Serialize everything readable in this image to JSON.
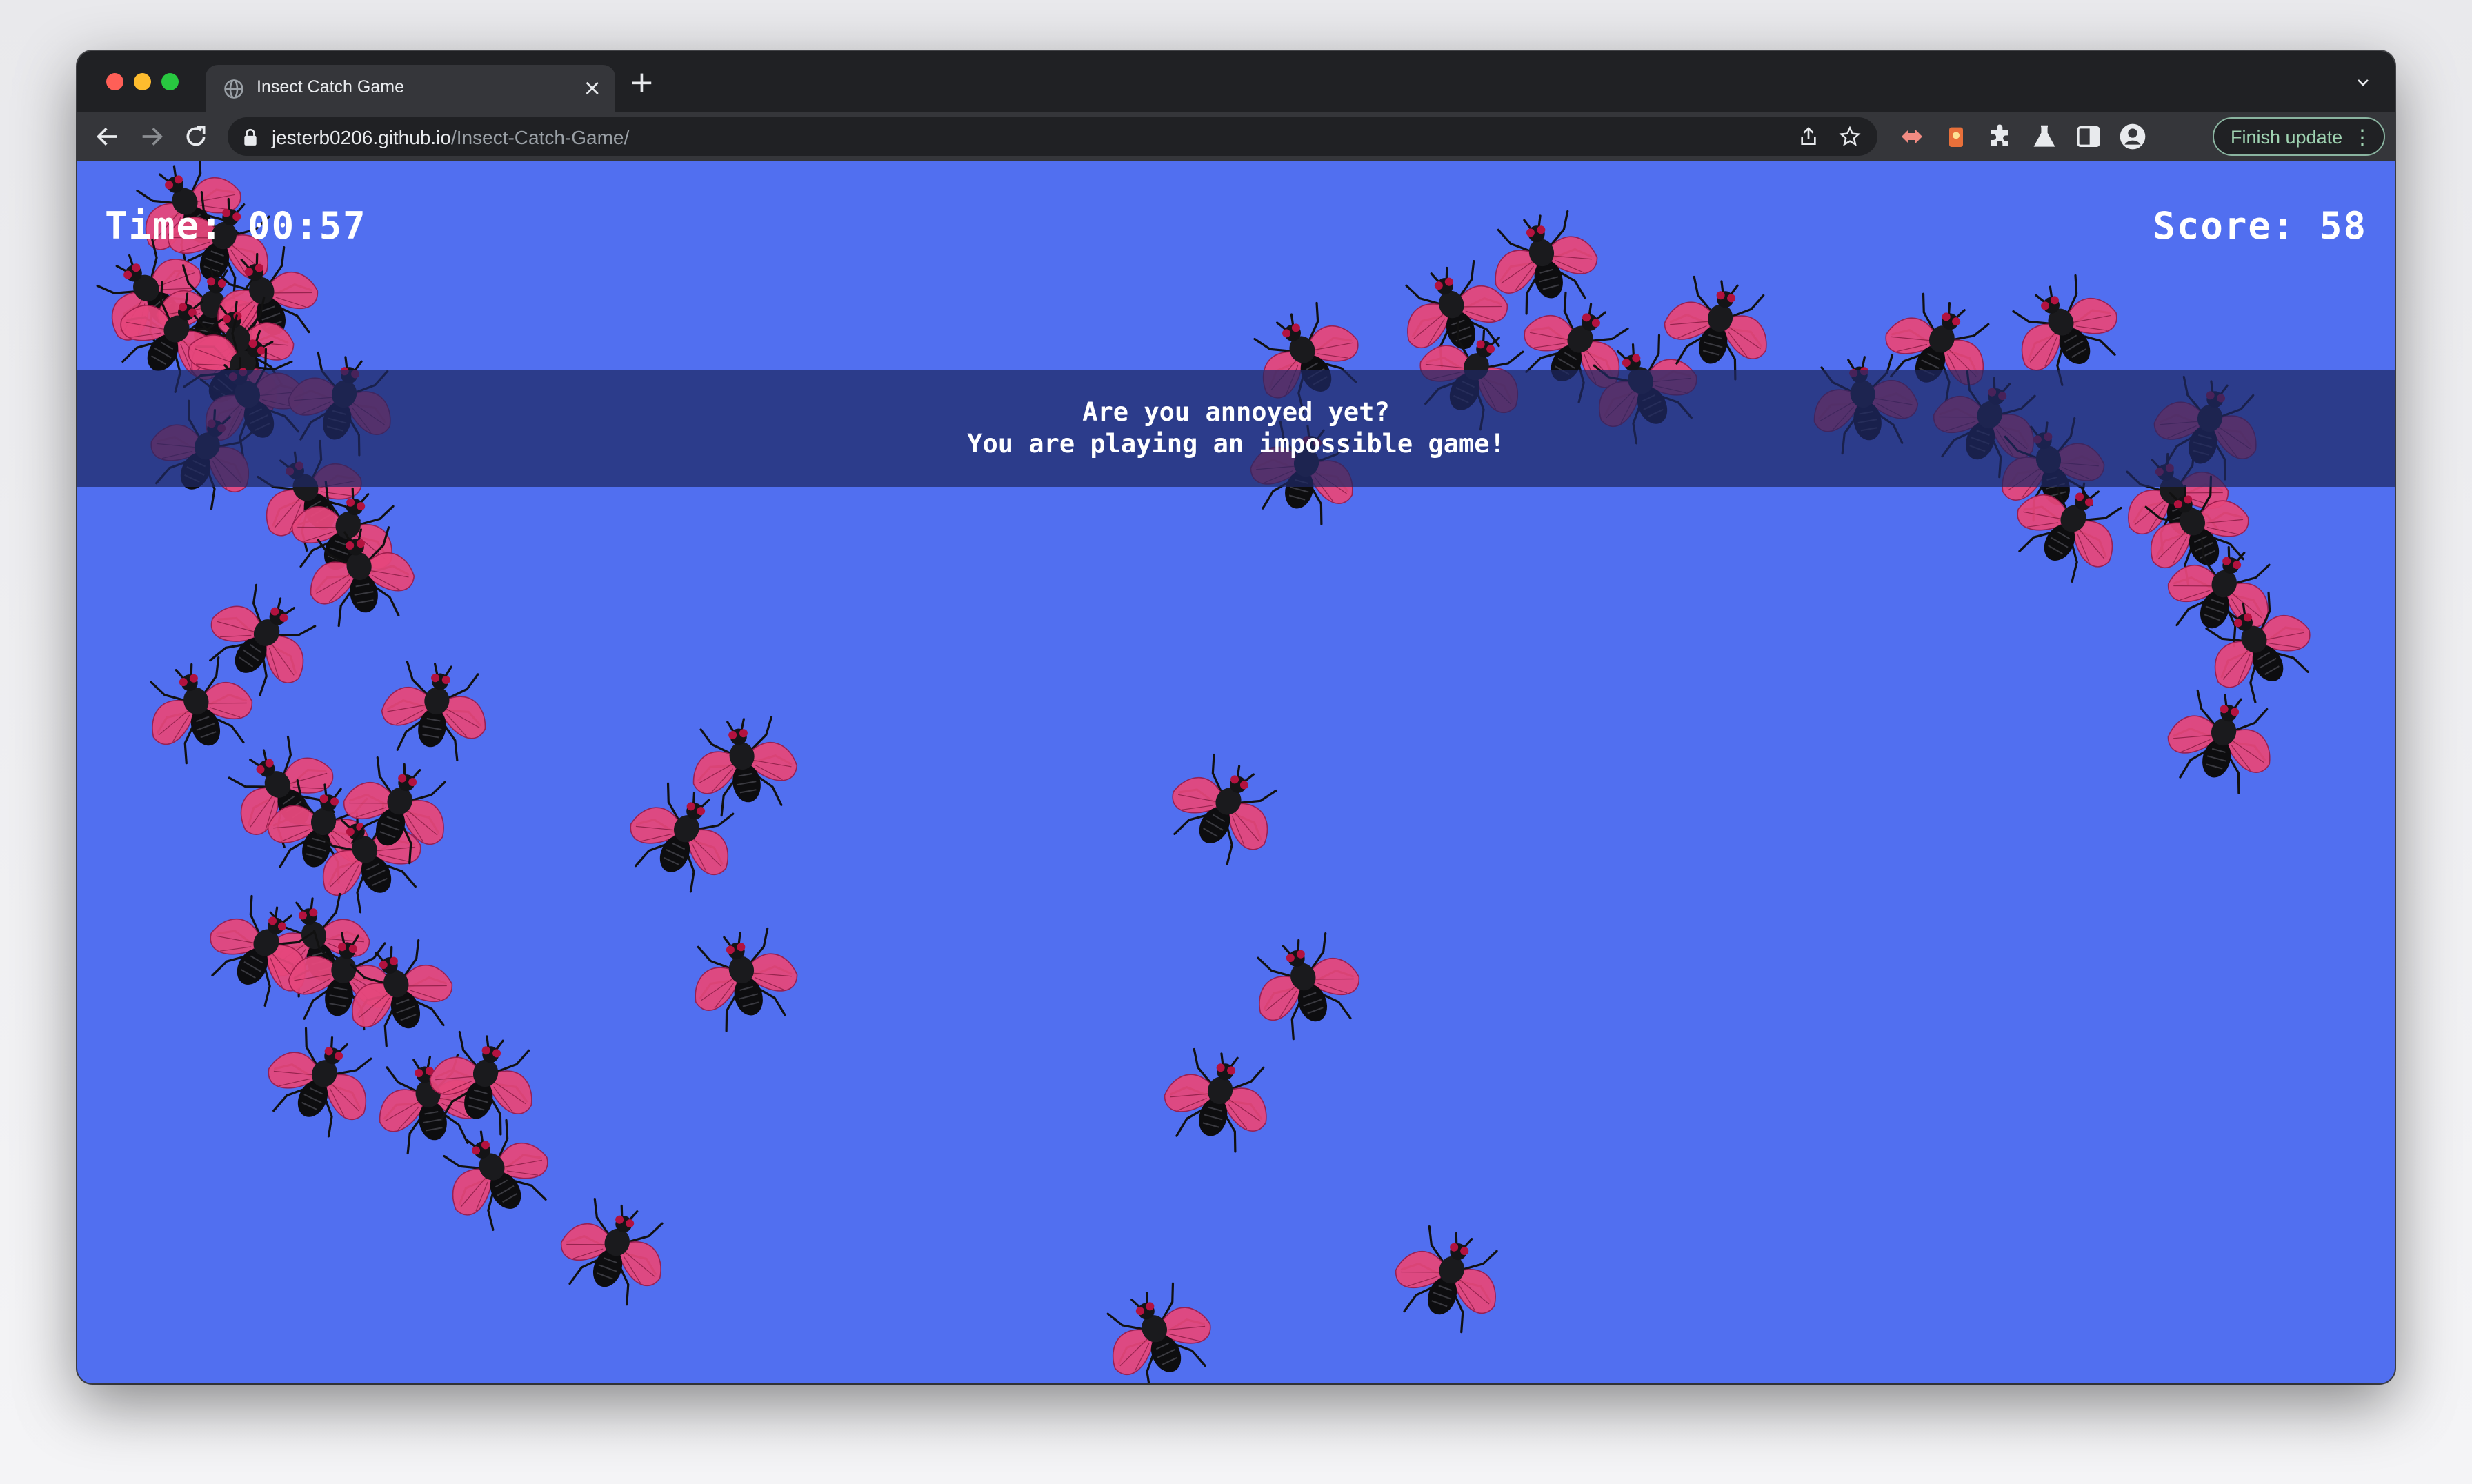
{
  "browser": {
    "tab_title": "Insect Catch Game",
    "tab_close": "×",
    "new_tab": "+",
    "url_host": "jesterb0206.github.io",
    "url_path": "/Insect-Catch-Game/",
    "finish_update_label": "Finish update",
    "finish_update_menu": "⋮"
  },
  "game": {
    "time_label": "Time:",
    "time_value": "00:57",
    "score_label": "Score:",
    "score_value": "58",
    "message_line1": "Are you annoyed yet?",
    "message_line2": "You are playing an impossible game!",
    "background_color": "#516ff0",
    "banner_color": "rgba(30,40,100,0.72)",
    "insect_type": "fly",
    "wing_color": "#e5477c"
  }
}
